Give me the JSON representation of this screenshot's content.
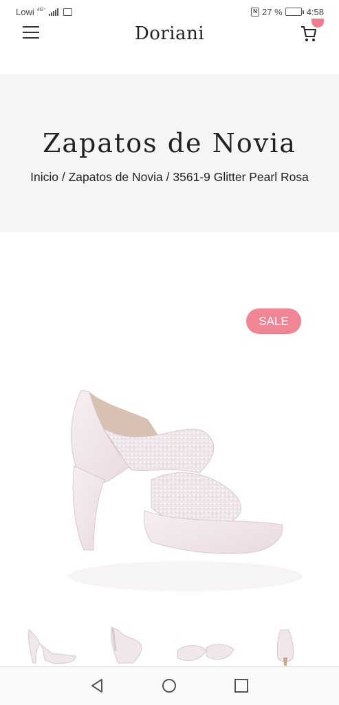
{
  "status_bar": {
    "carrier": "Lowi",
    "network": "4G⁺",
    "battery_percent": "27 %",
    "battery_level": 0.27,
    "time": "4:58"
  },
  "header": {
    "logo": "Doriani",
    "menu_icon": "hamburger-icon",
    "cart_icon": "cart-icon"
  },
  "hero": {
    "title": "Zapatos de Novia",
    "breadcrumb": {
      "home": "Inicio",
      "separator": " / ",
      "category": "Zapatos de Novia",
      "product": "3561-9 Glitter Pearl Rosa"
    }
  },
  "product": {
    "badge": "SALE",
    "badge_color": "#f08596",
    "thumbnails": [
      "side view",
      "front view",
      "sole view",
      "back view"
    ]
  },
  "nav_bar": {
    "back_icon": "back-triangle-icon",
    "home_icon": "home-circle-icon",
    "recents_icon": "recents-square-icon"
  }
}
